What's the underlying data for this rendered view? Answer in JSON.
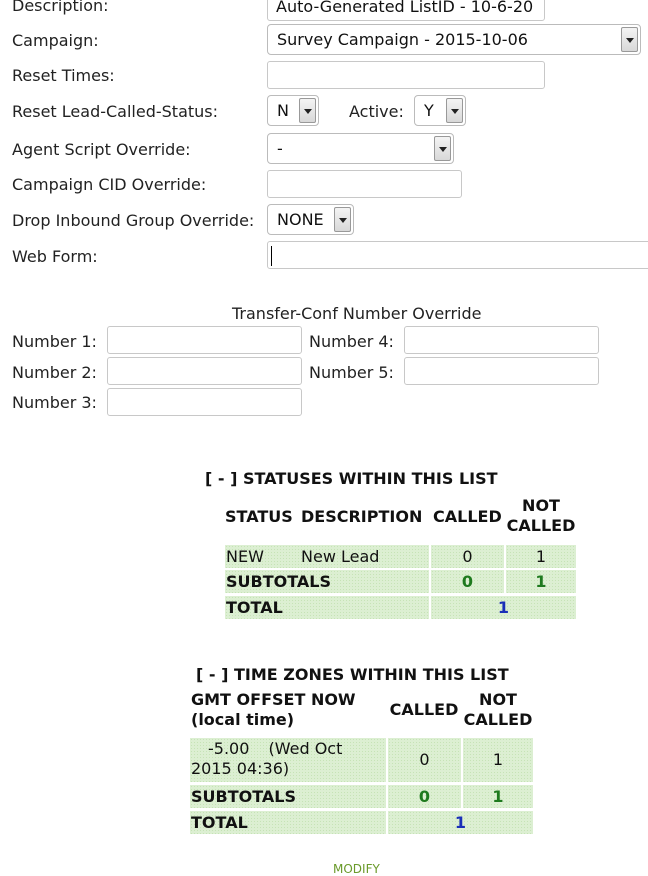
{
  "form": {
    "description": {
      "label": "Description:",
      "value": "Auto-Generated ListID - 10-6-20"
    },
    "campaign": {
      "label": "Campaign:",
      "value": "Survey Campaign - 2015-10-06"
    },
    "reset_times": {
      "label": "Reset Times:",
      "value": ""
    },
    "reset_lead_called_status": {
      "label": "Reset Lead-Called-Status:",
      "value": "N"
    },
    "active": {
      "label": "Active:",
      "value": "Y"
    },
    "agent_script_override": {
      "label": "Agent Script Override:",
      "value": "-"
    },
    "campaign_cid_override": {
      "label": "Campaign CID Override:",
      "value": ""
    },
    "drop_inbound_group_override": {
      "label": "Drop Inbound Group Override:",
      "value": "NONE"
    },
    "web_form": {
      "label": "Web Form:",
      "value": ""
    }
  },
  "transfer": {
    "title": "Transfer-Conf Number Override",
    "numbers": [
      {
        "label": "Number 1:",
        "value": ""
      },
      {
        "label": "Number 2:",
        "value": ""
      },
      {
        "label": "Number 3:",
        "value": ""
      },
      {
        "label": "Number 4:",
        "value": ""
      },
      {
        "label": "Number 5:",
        "value": ""
      }
    ]
  },
  "statuses": {
    "title": "[ - ] STATUSES WITHIN THIS LIST",
    "headers": {
      "status": "STATUS",
      "description": "DESCRIPTION",
      "called": "CALLED",
      "not_called": "NOT CALLED"
    },
    "rows": [
      {
        "status": "NEW",
        "description": "New Lead",
        "called": "0",
        "not_called": "1"
      }
    ],
    "subtotals": {
      "label": "SUBTOTALS",
      "called": "0",
      "not_called": "1"
    },
    "total": {
      "label": "TOTAL",
      "value": "1"
    }
  },
  "timezones": {
    "title": "[ - ] TIME ZONES WITHIN THIS LIST",
    "headers": {
      "gmt": "GMT OFFSET NOW (local time)",
      "called": "CALLED",
      "not_called": "NOT CALLED"
    },
    "rows": [
      {
        "offset": "-5.00",
        "local_time": "(Wed Oct 2015 04:36)",
        "called": "0",
        "not_called": "1"
      }
    ],
    "subtotals": {
      "label": "SUBTOTALS",
      "called": "0",
      "not_called": "1"
    },
    "total": {
      "label": "TOTAL",
      "value": "1"
    }
  },
  "footer": {
    "modify_label": "MODIFY"
  }
}
